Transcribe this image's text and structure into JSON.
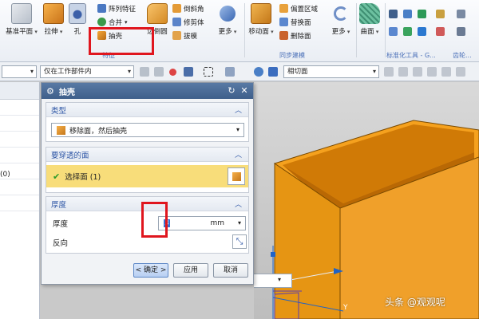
{
  "ribbon": {
    "datum_plane": "基准平面",
    "extrude": "拉伸",
    "hole_partial": "孔",
    "pattern_feature": "阵列特征",
    "unite": "合并",
    "shell": "抽壳",
    "edge_blend_partial": "边倒圆",
    "chamfer": "倒斜角",
    "trim_body": "修剪体",
    "draft": "拔模",
    "more": "更多",
    "move_face": "移动面",
    "offset_region": "偏置区域",
    "replace_face": "替换面",
    "delete_face": "删除面",
    "more2": "更多",
    "surface": "曲面",
    "group_feature_partial": "特征",
    "group_sync": "同步建模",
    "group_std_tools": "标准化工具 - G...",
    "group_gear_partial": "齿轮..."
  },
  "toolbar": {
    "filter_value": "",
    "scope_value": "仅在工作部件内",
    "face_rule_value": "相切面"
  },
  "left_panel": {
    "value_text": "(0)"
  },
  "dialog": {
    "title": "抽壳",
    "type_section": "类型",
    "type_value": "移除面，然后抽壳",
    "pierce_section": "要穿透的面",
    "select_face": "选择面 (1)",
    "thickness_section": "厚度",
    "thickness_label": "厚度",
    "thickness_value": "3",
    "thickness_unit": "mm",
    "reverse_label": "反向",
    "ok": "< 确定 >",
    "apply": "应用",
    "cancel": "取消"
  },
  "graphics": {
    "axis_y": "Y",
    "handle_input": ""
  },
  "watermark": "头条 @观观呢"
}
